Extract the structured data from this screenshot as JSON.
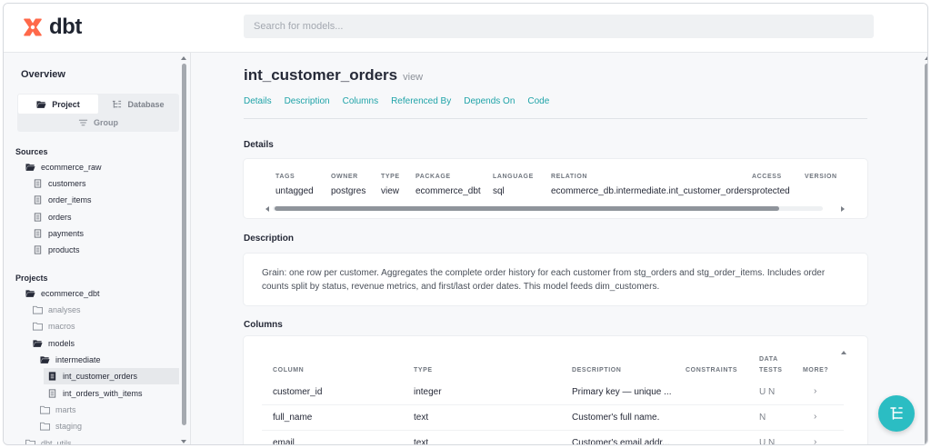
{
  "app": {
    "logo_text": "dbt",
    "brand_color": "#ff694a",
    "accent_color": "#1fa3a8"
  },
  "search": {
    "placeholder": "Search for models..."
  },
  "sidebar": {
    "overview": "Overview",
    "toggle": {
      "project": "Project",
      "database": "Database",
      "group": "Group",
      "active": "Project"
    },
    "sources_heading": "Sources",
    "sources": [
      {
        "label": "ecommerce_raw",
        "icon": "folder-open-icon"
      },
      {
        "label": "customers",
        "icon": "document-icon"
      },
      {
        "label": "order_items",
        "icon": "document-icon"
      },
      {
        "label": "orders",
        "icon": "document-icon"
      },
      {
        "label": "payments",
        "icon": "document-icon"
      },
      {
        "label": "products",
        "icon": "document-icon"
      }
    ],
    "projects_heading": "Projects",
    "projects": [
      {
        "label": "ecommerce_dbt",
        "icon": "folder-open-icon"
      },
      {
        "label": "analyses",
        "icon": "folder-icon"
      },
      {
        "label": "macros",
        "icon": "folder-icon"
      },
      {
        "label": "models",
        "icon": "folder-open-icon"
      },
      {
        "label": "intermediate",
        "icon": "folder-open-icon"
      },
      {
        "label": "int_customer_orders",
        "icon": "document-filled-icon",
        "selected": true
      },
      {
        "label": "int_orders_with_items",
        "icon": "document-icon"
      },
      {
        "label": "marts",
        "icon": "folder-icon"
      },
      {
        "label": "staging",
        "icon": "folder-icon"
      },
      {
        "label": "dbt_utils",
        "icon": "folder-icon"
      }
    ]
  },
  "main": {
    "model_name": "int_customer_orders",
    "model_kind": "view",
    "tabs": [
      "Details",
      "Description",
      "Columns",
      "Referenced By",
      "Depends On",
      "Code"
    ],
    "details_heading": "Details",
    "details": [
      {
        "label": "TAGS",
        "value": "untagged"
      },
      {
        "label": "OWNER",
        "value": "postgres"
      },
      {
        "label": "TYPE",
        "value": "view"
      },
      {
        "label": "PACKAGE",
        "value": "ecommerce_dbt"
      },
      {
        "label": "LANGUAGE",
        "value": "sql"
      },
      {
        "label": "RELATION",
        "value": "ecommerce_db.intermediate.int_customer_orders"
      },
      {
        "label": "ACCESS",
        "value": "protected"
      },
      {
        "label": "VERSION",
        "value": ""
      }
    ],
    "description_heading": "Description",
    "description": "Grain: one row per customer. Aggregates the complete order history for each customer from stg_orders and stg_order_items. Includes order counts split by status, revenue metrics, and first/last order dates. This model feeds dim_customers.",
    "columns_heading": "Columns",
    "column_headers": {
      "column": "COLUMN",
      "type": "TYPE",
      "description": "DESCRIPTION",
      "constraints": "CONSTRAINTS",
      "data_tests_1": "DATA",
      "data_tests_2": "TESTS",
      "more": "MORE?"
    },
    "columns": [
      {
        "name": "customer_id",
        "type": "integer",
        "description": "Primary key — unique ...",
        "constraints": "",
        "tests": "U N",
        "more": "›"
      },
      {
        "name": "full_name",
        "type": "text",
        "description": "Customer's full name.",
        "constraints": "",
        "tests": "N",
        "more": "›"
      },
      {
        "name": "email",
        "type": "text",
        "description": "Customer's email addr...",
        "constraints": "",
        "tests": "U N",
        "more": "›"
      }
    ]
  },
  "fab": {
    "icon": "lineage-graph-icon"
  }
}
